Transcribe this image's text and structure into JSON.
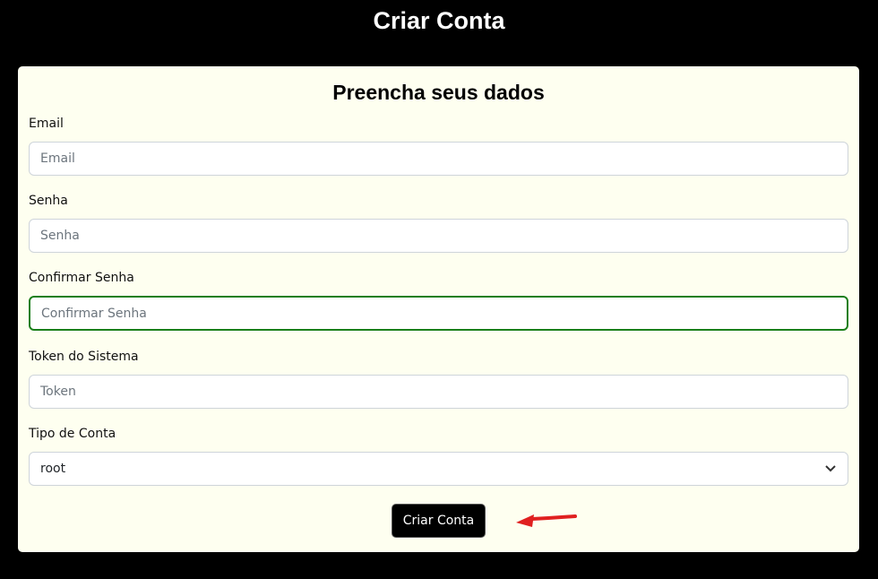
{
  "header": {
    "title": "Criar Conta"
  },
  "form": {
    "title": "Preencha seus dados",
    "email": {
      "label": "Email",
      "placeholder": "Email",
      "value": ""
    },
    "senha": {
      "label": "Senha",
      "placeholder": "Senha",
      "value": ""
    },
    "confirmar": {
      "label": "Confirmar Senha",
      "placeholder": "Confirmar Senha",
      "value": ""
    },
    "token": {
      "label": "Token do Sistema",
      "placeholder": "Token",
      "value": ""
    },
    "tipo": {
      "label": "Tipo de Conta",
      "selected": "root"
    },
    "submit_label": "Criar Conta"
  },
  "annotation_color": "#e02020"
}
